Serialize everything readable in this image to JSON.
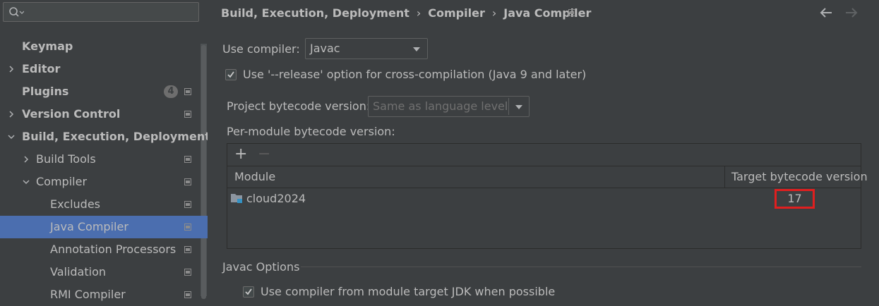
{
  "sidebar": {
    "search": {
      "value": "",
      "placeholder": ""
    },
    "items": [
      {
        "label": "Keymap",
        "bold": true
      },
      {
        "label": "Editor",
        "bold": true
      },
      {
        "label": "Plugins",
        "bold": true,
        "badge": "4"
      },
      {
        "label": "Version Control",
        "bold": true
      },
      {
        "label": "Build, Execution, Deployment",
        "bold": true
      },
      {
        "label": "Build Tools",
        "bold": false
      },
      {
        "label": "Compiler",
        "bold": false
      },
      {
        "label": "Excludes",
        "bold": false
      },
      {
        "label": "Java Compiler",
        "bold": false,
        "selected": true
      },
      {
        "label": "Annotation Processors",
        "bold": false
      },
      {
        "label": "Validation",
        "bold": false
      },
      {
        "label": "RMI Compiler",
        "bold": false
      }
    ]
  },
  "header": {
    "breadcrumbs": [
      "Build, Execution, Deployment",
      "Compiler",
      "Java Compiler"
    ],
    "separator": "›"
  },
  "form": {
    "use_compiler_label": "Use compiler:",
    "use_compiler_value": "Javac",
    "release_option_label": "Use '--release' option for cross-compilation (Java 9 and later)",
    "release_option_checked": true,
    "project_bytecode_label": "Project bytecode version:",
    "project_bytecode_value": "Same as language level",
    "per_module_label": "Per-module bytecode version:",
    "toolbar": {
      "add": "+",
      "remove": "−"
    },
    "table": {
      "columns": [
        "Module",
        "Target bytecode version"
      ],
      "rows": [
        {
          "module": "cloud2024",
          "target": "17"
        }
      ]
    },
    "javac_options_label": "Javac Options",
    "use_module_jdk_label": "Use compiler from module target JDK when possible",
    "use_module_jdk_checked": true
  },
  "colors": {
    "background": "#3c3f41",
    "selection": "#4b6eaf",
    "highlight_box": "#e01f1f",
    "text": "#bbbbbb"
  }
}
